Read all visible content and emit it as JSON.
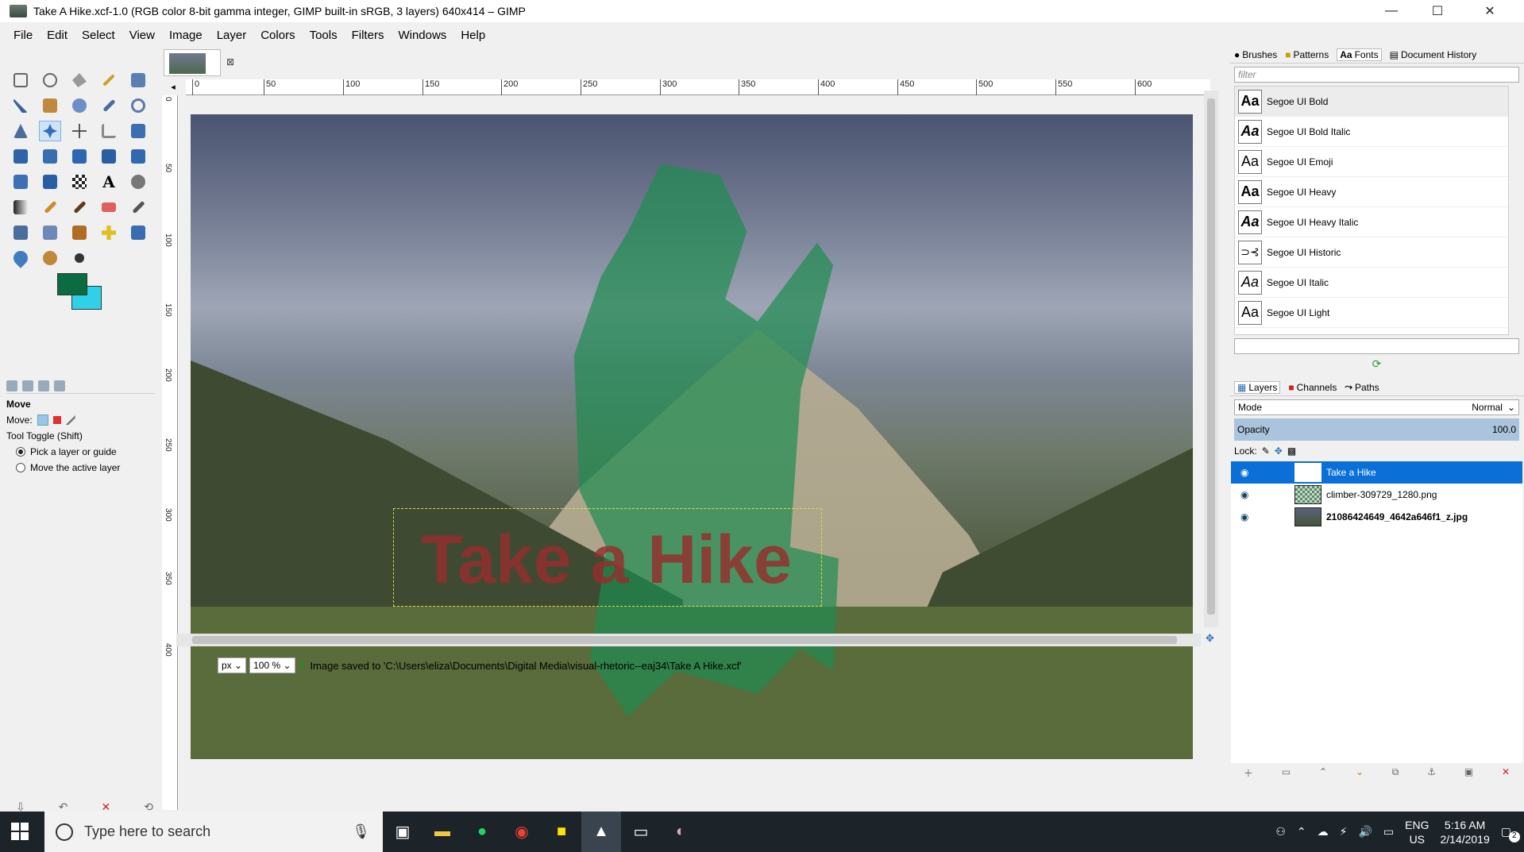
{
  "window": {
    "title": "Take A Hike.xcf-1.0 (RGB color 8-bit gamma integer, GIMP built-in sRGB, 3 layers) 640x414 – GIMP",
    "minimize_glyph": "—",
    "maximize_glyph": "☐",
    "close_glyph": "✕"
  },
  "menubar": [
    "File",
    "Edit",
    "Select",
    "View",
    "Image",
    "Layer",
    "Colors",
    "Tools",
    "Filters",
    "Windows",
    "Help"
  ],
  "colors": {
    "foreground": "#0d6b44",
    "background": "#2ed2e8",
    "selected_layer": "#0a6fd6",
    "hike_text": "#962d2d"
  },
  "tool_options": {
    "tool_name": "Move",
    "move_label": "Move:",
    "toggle_label": "Tool Toggle  (Shift)",
    "option_pick": "Pick a layer or guide",
    "option_active": "Move the active layer"
  },
  "rulers": {
    "horizontal": [
      "0",
      "50",
      "100",
      "150",
      "200",
      "250",
      "300",
      "350",
      "400",
      "450",
      "500",
      "550",
      "600"
    ],
    "vertical": [
      "0",
      "50",
      "100",
      "150",
      "200",
      "250",
      "300",
      "350",
      "400"
    ]
  },
  "canvas": {
    "text_layer": "Take a Hike"
  },
  "statusbar": {
    "unit": "px",
    "zoom": "100 %",
    "message": "Image saved to 'C:\\Users\\eliza\\Documents\\Digital Media\\visual-rhetoric--eaj34\\Take A Hike.xcf'"
  },
  "dock_top": {
    "tabs": [
      "Brushes",
      "Patterns",
      "Fonts",
      "Document History"
    ],
    "filter_placeholder": "filter",
    "fonts": [
      "Segoe UI Bold",
      "Segoe UI Bold Italic",
      "Segoe UI Emoji",
      "Segoe UI Heavy",
      "Segoe UI Heavy Italic",
      "Segoe UI Historic",
      "Segoe UI Italic",
      "Segoe UI Light"
    ]
  },
  "dock_layers": {
    "tabs": [
      "Layers",
      "Channels",
      "Paths"
    ],
    "mode_label": "Mode",
    "mode_value": "Normal",
    "opacity_label": "Opacity",
    "opacity_value": "100.0",
    "lock_label": "Lock:",
    "layers": [
      "Take a Hike",
      "climber-309729_1280.png",
      "21086424649_4642a646f1_z.jpg"
    ]
  },
  "taskbar": {
    "search_placeholder": "Type here to search",
    "lang_top": "ENG",
    "lang_bottom": "US",
    "time": "5:16 AM",
    "date": "2/14/2019",
    "notifications": "2"
  }
}
